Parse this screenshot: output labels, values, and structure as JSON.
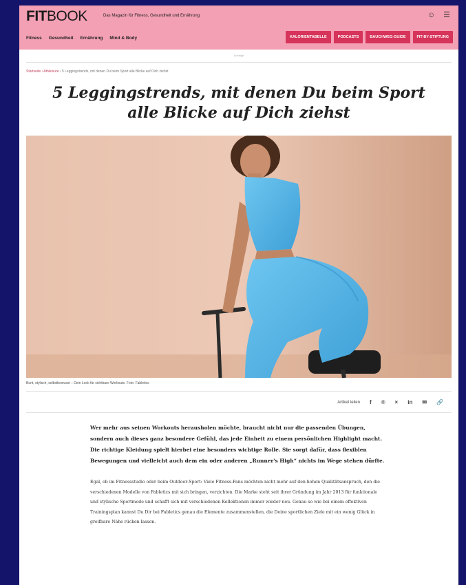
{
  "header": {
    "logo_bold": "FIT",
    "logo_light": "BOOK",
    "tagline": "Das Magazin für Fitness, Gesundheit und Ernährung",
    "nav": [
      "Fitness",
      "Gesundheit",
      "Ernährung",
      "Mind & Body"
    ],
    "buttons": [
      "KALORIENTABELLE",
      "PODCASTS",
      "BAUCHWEG-GUIDE",
      "FIT-BY-STIFTUNG"
    ],
    "icons": [
      "user-icon",
      "menu-icon"
    ],
    "ad_label": "Anzeige"
  },
  "breadcrumb": {
    "link": "Startseite › Athleisure",
    "rest": "› 5 Leggingstrends, mit denen Du beim Sport alle Blicke auf Dich ziehst"
  },
  "article": {
    "title": "5 Leggingstrends, mit denen Du beim Sport alle Blicke auf Dich ziehst",
    "caption": "Bunt, stylisch, selbstbewusst – Dein Look für sichtbare Workouts. Foto: Fabletics",
    "share_label": "Artikel teilen",
    "share_icons": [
      "facebook-icon",
      "pinterest-icon",
      "x-icon",
      "linkedin-icon",
      "mail-icon",
      "link-icon"
    ],
    "lead": "Wer mehr aus seinen Workouts herausholen möchte, braucht nicht nur die passenden Übungen, sondern auch dieses ganz besondere Gefühl, das jede Einheit zu einem persönlichen Highlight macht. Die richtige Kleidung spielt hierbei eine besonders wichtige Rolle. Sie sorgt dafür, dass flexiblen Bewegungen und vielleicht auch dem ein oder anderen „Runner's High“ nichts im Wege stehen dürfte.",
    "body": "Egal, ob im Fitnessstudio oder beim Outdoor-Sport: Viele Fitness-Fans möchten nicht mehr auf den hohen Qualitätsanspruch, den die verschiedenen Modelle von Fabletics mit sich bringen, verzichten. Die Marke steht seit ihrer Gründung im Jahr 2013 für funktionale und stylische Sportmode und schafft sich mit verschiedenen Kollektionen immer wieder neu. Genau so wie bei einem effektiven Trainingsplan kannst Du Dir bei Fabletics genau die Elemente zusammenstellen, die Deine sportlichen Ziele mit ein wenig Glück in greifbare Nähe rücken lassen."
  },
  "colors": {
    "header_bg": "#f4a0b4",
    "button_bg": "#d6345a",
    "outfit": "#5bb8ea"
  }
}
